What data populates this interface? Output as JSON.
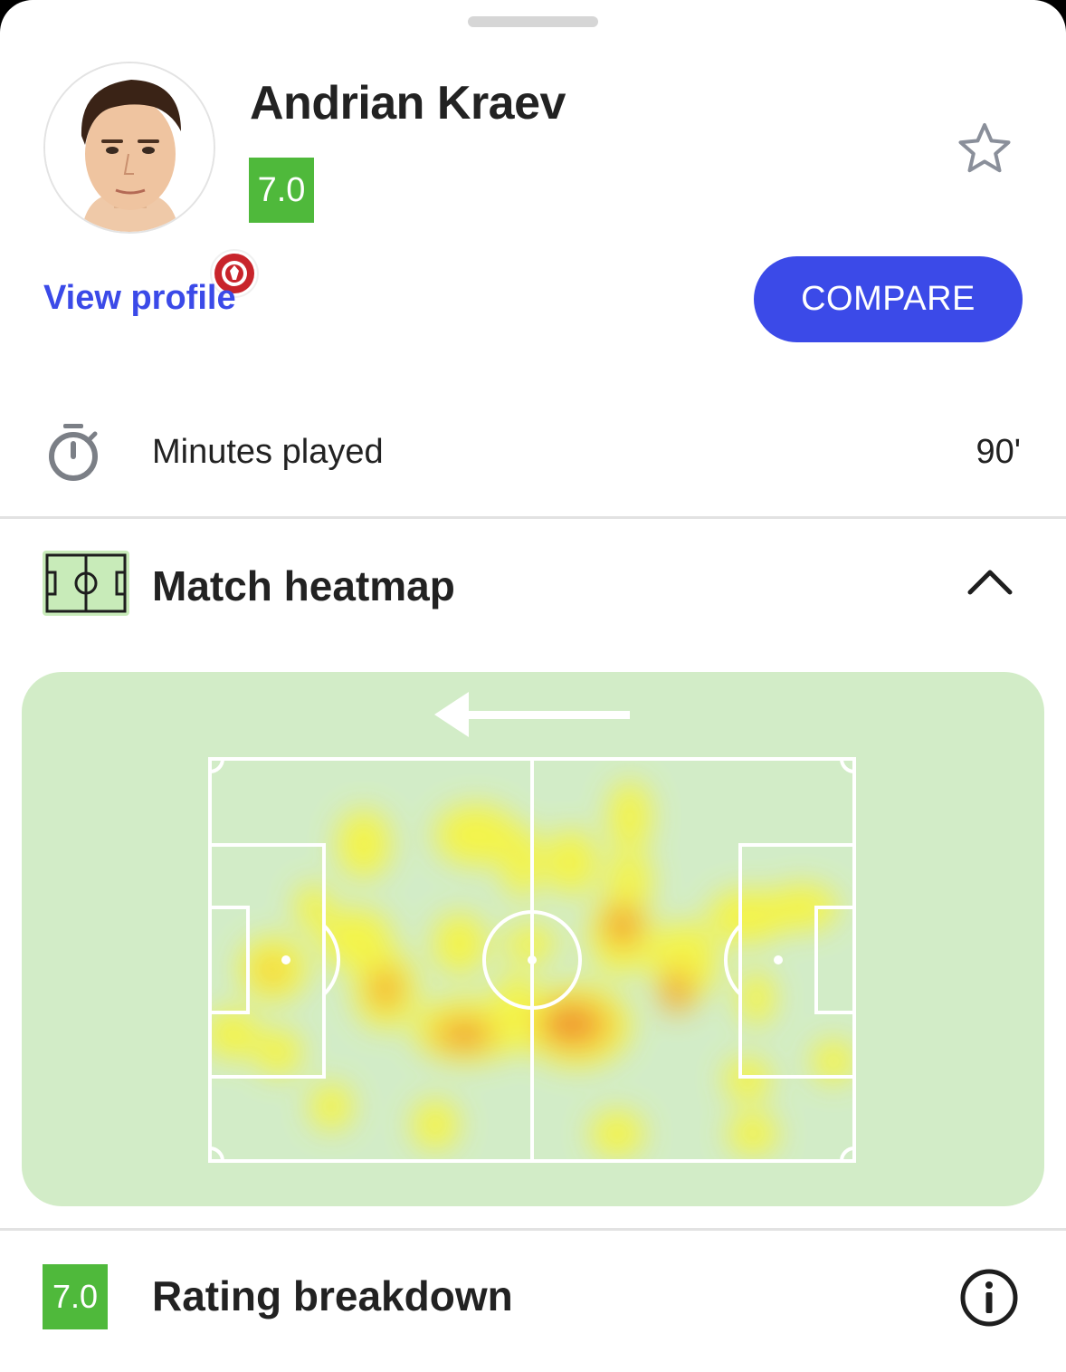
{
  "player": {
    "name": "Andrian Kraev",
    "rating": "7.0",
    "avatar_icon": "player-photo",
    "club_icon": "hapoel-tel-aviv-crest"
  },
  "actions": {
    "view_profile": "View profile",
    "compare": "COMPARE",
    "favorite_icon": "star-outline-icon"
  },
  "stats": {
    "minutes_label": "Minutes played",
    "minutes_value": "90'"
  },
  "heatmap": {
    "title": "Match heatmap",
    "attack_direction": "left",
    "colors": {
      "pitch_bg": "#d2ecc7",
      "low": "#f5f542",
      "mid": "#f7c531",
      "high": "#f07a22"
    }
  },
  "rating_breakdown": {
    "rating": "7.0",
    "title": "Rating breakdown"
  },
  "colors": {
    "accent": "#3b4ae8",
    "rating_green": "#4fb93b"
  }
}
